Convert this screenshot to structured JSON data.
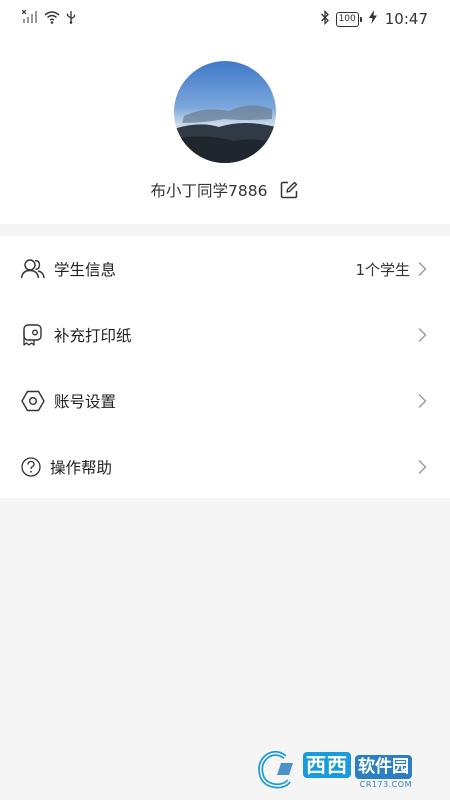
{
  "status_bar": {
    "time": "10:47",
    "battery": "100"
  },
  "profile": {
    "username": "布小丁同学7886"
  },
  "menu": {
    "items": [
      {
        "label": "学生信息",
        "value": "1个学生",
        "icon": "user-group-icon"
      },
      {
        "label": "补充打印纸",
        "value": "",
        "icon": "paper-roll-icon"
      },
      {
        "label": "账号设置",
        "value": "",
        "icon": "hex-settings-icon"
      },
      {
        "label": "操作帮助",
        "value": "",
        "icon": "help-circle-icon"
      }
    ]
  },
  "watermark": {
    "name_a": "西西",
    "name_b": "软件园",
    "url": "CR173.COM"
  }
}
